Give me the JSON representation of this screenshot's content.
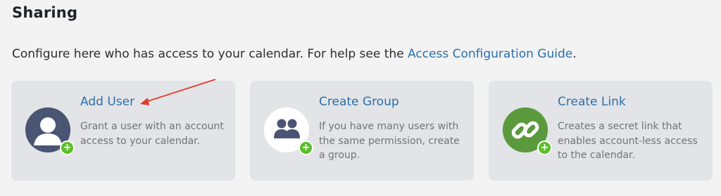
{
  "section": {
    "title": "Sharing"
  },
  "intro": {
    "text": "Configure here who has access to your calendar. For help see the ",
    "link": "Access Configuration Guide",
    "suffix": "."
  },
  "cards": [
    {
      "title": "Add User",
      "description": "Grant a user with an account access to your calendar.",
      "icon": "user-avatar-icon",
      "color": "#4a5573"
    },
    {
      "title": "Create Group",
      "description": "If you have many users with the same permission, create a group.",
      "icon": "group-icon",
      "color": "#ffffff"
    },
    {
      "title": "Create Link",
      "description": "Creates a secret link that enables account-less access to the calendar.",
      "icon": "link-icon",
      "color": "#5a9a3c"
    }
  ],
  "colors": {
    "accent": "#2a6fab",
    "plus_badge": "#5cbf2a",
    "arrow": "#e53a2f"
  }
}
